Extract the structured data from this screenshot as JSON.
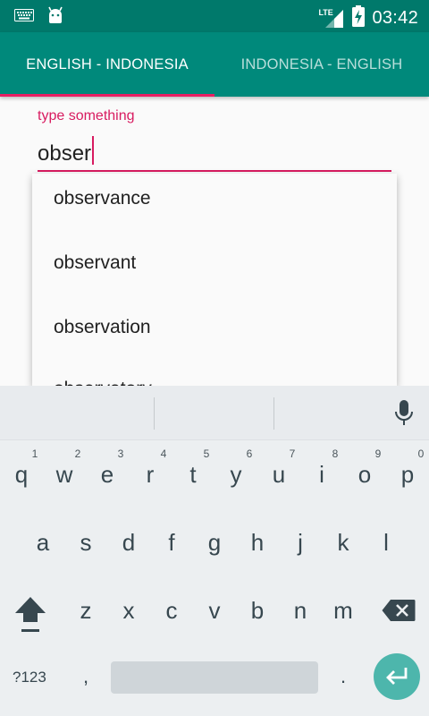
{
  "status_bar": {
    "time": "03:42",
    "network": "LTE",
    "icons": [
      "keyboard-icon",
      "android-icon",
      "signal-icon",
      "battery-charging-icon"
    ]
  },
  "tabs": [
    {
      "label": "ENGLISH - INDONESIA",
      "selected": true
    },
    {
      "label": "INDONESIA - ENGLISH",
      "selected": false
    }
  ],
  "search": {
    "label": "type something",
    "value": "obser"
  },
  "suggestions": [
    "observance",
    "observant",
    "observation",
    "observatory"
  ],
  "keyboard": {
    "row1": [
      "q",
      "w",
      "e",
      "r",
      "t",
      "y",
      "u",
      "i",
      "o",
      "p"
    ],
    "row1_hints": [
      "1",
      "2",
      "3",
      "4",
      "5",
      "6",
      "7",
      "8",
      "9",
      "0"
    ],
    "row2": [
      "a",
      "s",
      "d",
      "f",
      "g",
      "h",
      "j",
      "k",
      "l"
    ],
    "row3": [
      "z",
      "x",
      "c",
      "v",
      "b",
      "n",
      "m"
    ],
    "symbols_label": "?123",
    "comma": ",",
    "period": "."
  },
  "colors": {
    "status_bar": "#00796b",
    "tab_bar": "#00897b",
    "accent": "#d81b60",
    "enter_button": "#4db6ac"
  }
}
